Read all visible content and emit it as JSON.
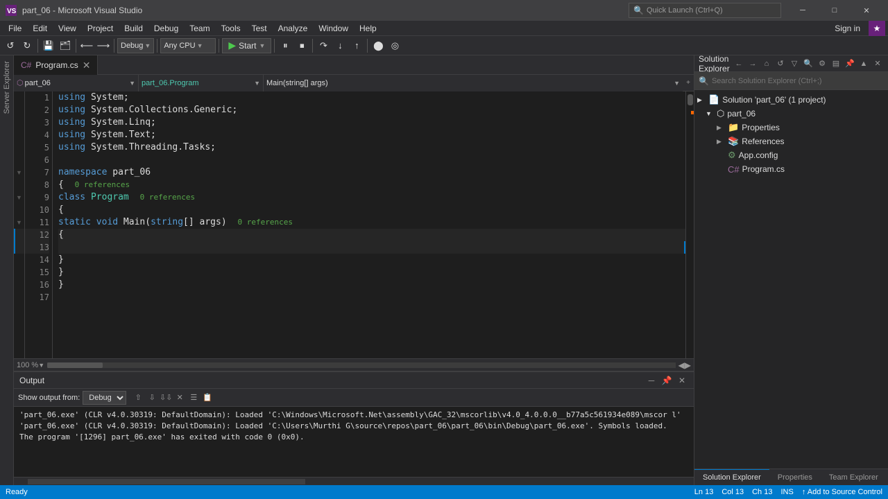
{
  "titleBar": {
    "appIcon": "VS",
    "title": "part_06 - Microsoft Visual Studio",
    "minimize": "─",
    "maximize": "□",
    "close": "✕"
  },
  "menuBar": {
    "items": [
      "File",
      "Edit",
      "View",
      "Project",
      "Build",
      "Debug",
      "Team",
      "Tools",
      "Test",
      "Analyze",
      "Window",
      "Help"
    ]
  },
  "toolbar": {
    "debugMode": "Debug",
    "platform": "Any CPU",
    "startLabel": "Start",
    "signIn": "Sign in"
  },
  "tabs": [
    {
      "label": "Program.cs",
      "active": true
    }
  ],
  "navBar": {
    "project": "part_06",
    "class": "part_06.Program",
    "method": "Main(string[] args)"
  },
  "code": {
    "lines": [
      {
        "num": 1,
        "fold": "",
        "text": "using System;",
        "tokens": [
          {
            "t": "kw",
            "v": "using"
          },
          {
            "t": "nm",
            "v": " System;"
          }
        ]
      },
      {
        "num": 2,
        "fold": "",
        "text": "using System.Collections.Generic;",
        "tokens": [
          {
            "t": "kw",
            "v": "using"
          },
          {
            "t": "nm",
            "v": " System.Collections.Generic;"
          }
        ]
      },
      {
        "num": 3,
        "fold": "",
        "text": "using System.Linq;",
        "tokens": [
          {
            "t": "kw",
            "v": "using"
          },
          {
            "t": "nm",
            "v": " System.Linq;"
          }
        ]
      },
      {
        "num": 4,
        "fold": "",
        "text": "using System.Text;",
        "tokens": [
          {
            "t": "kw",
            "v": "using"
          },
          {
            "t": "nm",
            "v": " System.Text;"
          }
        ]
      },
      {
        "num": 5,
        "fold": "",
        "text": "using System.Threading.Tasks;",
        "tokens": [
          {
            "t": "kw",
            "v": "using"
          },
          {
            "t": "nm",
            "v": " System.Threading.Tasks;"
          }
        ]
      },
      {
        "num": 6,
        "fold": "",
        "text": "",
        "tokens": []
      },
      {
        "num": 7,
        "fold": "▼",
        "text": "namespace part_06",
        "tokens": [
          {
            "t": "kw",
            "v": "namespace"
          },
          {
            "t": "nm",
            "v": " part_06"
          }
        ]
      },
      {
        "num": 8,
        "fold": "",
        "text": "{",
        "tokens": [
          {
            "t": "nm",
            "v": "{"
          }
        ],
        "ref": "0 references"
      },
      {
        "num": 9,
        "fold": "▼",
        "text": "    class Program",
        "tokens": [
          {
            "t": "nm",
            "v": "    "
          },
          {
            "t": "kw",
            "v": "class"
          },
          {
            "t": "nm",
            "v": " Program"
          }
        ],
        "ref": "0 references"
      },
      {
        "num": 10,
        "fold": "",
        "text": "    {",
        "tokens": [
          {
            "t": "nm",
            "v": "    {"
          }
        ]
      },
      {
        "num": 11,
        "fold": "▼",
        "text": "        static void Main(string[] args)",
        "tokens": [
          {
            "t": "nm",
            "v": "        "
          },
          {
            "t": "kw",
            "v": "static"
          },
          {
            "t": "nm",
            "v": " "
          },
          {
            "t": "kw",
            "v": "void"
          },
          {
            "t": "nm",
            "v": " Main("
          },
          {
            "t": "kw",
            "v": "string"
          },
          {
            "t": "nm",
            "v": "[] args)"
          }
        ],
        "ref": "0 references"
      },
      {
        "num": 12,
        "fold": "",
        "text": "        {",
        "tokens": [
          {
            "t": "nm",
            "v": "        {"
          }
        ],
        "active": true
      },
      {
        "num": 13,
        "fold": "",
        "text": "            ",
        "tokens": [
          {
            "t": "nm",
            "v": "            "
          }
        ],
        "active": true
      },
      {
        "num": 14,
        "fold": "",
        "text": "        }",
        "tokens": [
          {
            "t": "nm",
            "v": "        }"
          }
        ]
      },
      {
        "num": 15,
        "fold": "",
        "text": "    }",
        "tokens": [
          {
            "t": "nm",
            "v": "    }"
          }
        ]
      },
      {
        "num": 16,
        "fold": "",
        "text": "}",
        "tokens": [
          {
            "t": "nm",
            "v": "}"
          }
        ]
      },
      {
        "num": 17,
        "fold": "",
        "text": "",
        "tokens": []
      }
    ]
  },
  "zoomLevel": "100 %",
  "output": {
    "title": "Output",
    "sourceLabel": "Show output from:",
    "sourceValue": "Debug",
    "lines": [
      "'part_06.exe' (CLR v4.0.30319: DefaultDomain): Loaded 'C:\\Windows\\Microsoft.Net\\assembly\\GAC_32\\mscorlib\\v4.0_4.0.0.0__b77a5c561934e089\\mscor l'",
      "'part_06.exe' (CLR v4.0.30319: DefaultDomain): Loaded 'C:\\Users\\Murthi G\\source\\repos\\part_06\\part_06\\bin\\Debug\\part_06.exe'. Symbols loaded.",
      "The program '[1296] part_06.exe' has exited with code 0 (0x0)."
    ]
  },
  "solutionExplorer": {
    "title": "Solution Explorer",
    "searchPlaceholder": "Search Solution Explorer (Ctrl+;)",
    "tree": [
      {
        "level": 0,
        "icon": "solution",
        "label": "Solution 'part_06' (1 project)",
        "arrow": "▶",
        "expanded": true
      },
      {
        "level": 1,
        "icon": "project",
        "label": "part_06",
        "arrow": "▼",
        "expanded": true,
        "selected": false
      },
      {
        "level": 2,
        "icon": "folder",
        "label": "Properties",
        "arrow": "▶",
        "expanded": false
      },
      {
        "level": 2,
        "icon": "folder",
        "label": "References",
        "arrow": "▶",
        "expanded": false
      },
      {
        "level": 2,
        "icon": "config",
        "label": "App.config",
        "arrow": "",
        "expanded": false
      },
      {
        "level": 2,
        "icon": "cs",
        "label": "Program.cs",
        "arrow": "",
        "expanded": false
      }
    ],
    "bottomTabs": [
      "Solution Explorer",
      "Properties",
      "Team Explorer"
    ]
  },
  "statusBar": {
    "ready": "Ready",
    "ln": "Ln 13",
    "col": "Col 13",
    "ch": "Ch 13",
    "ins": "INS",
    "addSourceControl": "Add to Source Control"
  }
}
